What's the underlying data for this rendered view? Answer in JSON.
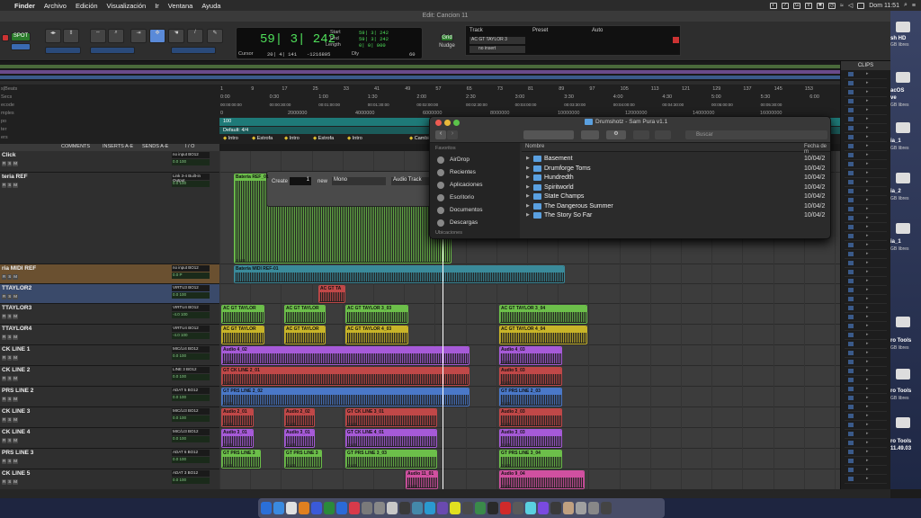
{
  "menubar": {
    "app": "Finder",
    "items": [
      "Archivo",
      "Edición",
      "Visualización",
      "Ir",
      "Ventana",
      "Ayuda"
    ],
    "clock": "Dom 11:51"
  },
  "edit_window": {
    "title": "Edit: Cancion 11"
  },
  "transport": {
    "main_counter": "59| 3| 242",
    "start_label": "Start",
    "end_label": "End",
    "length_label": "Length",
    "start_val": "59| 3| 242",
    "end_val": "59| 3| 242",
    "length_val": "0| 0| 000",
    "cursor_label": "Cursor",
    "cursor_val": "20| 4| 141",
    "sample_val": "-1216805",
    "dly_label": "Dly",
    "tempo_val": "60",
    "grid_label": "Grid",
    "nudge_label": "Nudge",
    "spot_label": "SPOT"
  },
  "track_panel": {
    "track_label": "Track",
    "preset_label": "Preset",
    "auto_label": "Auto",
    "track_value": "AC GT TAYLOR 3",
    "insert_value": "no insert"
  },
  "rulers": {
    "labels": [
      "s|Beats",
      "Secs",
      "ecode",
      "mples",
      "po",
      "ter",
      "ers"
    ],
    "bars": [
      "1",
      "9",
      "17",
      "25",
      "33",
      "41",
      "49",
      "57",
      "65",
      "73",
      "81",
      "89",
      "97",
      "105",
      "113",
      "121",
      "129",
      "137",
      "145",
      "153"
    ],
    "mins": [
      "0:00",
      "0:30",
      "1:00",
      "1:30",
      "2:00",
      "2:30",
      "3:00",
      "3:30",
      "4:00",
      "4:30",
      "5:00",
      "5:30",
      "6:00"
    ],
    "timecode": [
      "00:00:00:00",
      "00:00:30:00",
      "00:01:00:00",
      "00:01:30:00",
      "00:02:00:00",
      "00:02:30:00",
      "00:03:00:00",
      "00:03:30:00",
      "00:04:00:00",
      "00:04:30:00",
      "00:05:00:00",
      "00:05:30:00"
    ],
    "samples": [
      "0",
      "2000000",
      "4000000",
      "6000000",
      "8000000",
      "10000000",
      "12000000",
      "14000000",
      "16000000"
    ],
    "tempo": "100",
    "meter": "Default: 4/4",
    "markers": [
      "Intro",
      "Estrofa",
      "Intro",
      "Estrofa",
      "Intro",
      "Cambio"
    ]
  },
  "column_headers": {
    "comments": "COMMENTS",
    "inserts": "INSERTS A-E",
    "sends": "SENDS A-E",
    "io": "I / O"
  },
  "tracks": [
    {
      "name": "Click",
      "io1": "no input",
      "io2": "BO12",
      "vol": "0.0",
      "pan": "100"
    },
    {
      "name": "teria REF",
      "io1": "Link 3-4",
      "io2": "Built-in Output",
      "vol": "0.0",
      "pan": "100"
    },
    {
      "name": "ria MIDI REF",
      "io1": "no input",
      "io2": "BO12",
      "vol": "0.0",
      "pan": "P"
    },
    {
      "name": "TTAYLOR2",
      "io1": "VIRTU3",
      "io2": "BO12",
      "vol": "0.0",
      "pan": "100"
    },
    {
      "name": "TTAYLOR3",
      "io1": "VIRTU4",
      "io2": "BO12",
      "vol": "-4.0",
      "pan": "100"
    },
    {
      "name": "TTAYLOR4",
      "io1": "VIRTU4",
      "io2": "BO12",
      "vol": "-4.0",
      "pan": "100"
    },
    {
      "name": "CK LINE 1",
      "io1": "MIC/LI4",
      "io2": "BO12",
      "vol": "0.0",
      "pan": "100"
    },
    {
      "name": "CK LINE 2",
      "io1": "LINE 3",
      "io2": "BO12",
      "vol": "0.0",
      "pan": "100"
    },
    {
      "name": "PRS LINE 2",
      "io1": "ADAT 5",
      "io2": "BO12",
      "vol": "0.0",
      "pan": "100"
    },
    {
      "name": "CK LINE 3",
      "io1": "MIC/LI3",
      "io2": "BO12",
      "vol": "0.0",
      "pan": "100"
    },
    {
      "name": "CK LINE 4",
      "io1": "MIC/LI3",
      "io2": "BO12",
      "vol": "0.0",
      "pan": "100"
    },
    {
      "name": "PRS LINE 3",
      "io1": "ADAT 6",
      "io2": "BO12",
      "vol": "0.0",
      "pan": "100"
    },
    {
      "name": "CK LINE 5",
      "io1": "ADAT 3",
      "io2": "BO12",
      "vol": "0.0",
      "pan": "100"
    }
  ],
  "clips": {
    "bateria_ref": "Batería REF_01",
    "bateria_midi": "Batería MIDI REF-01",
    "ac_gt_ta": "AC GT TA",
    "taylor3_a": "AC GT TAYLOR",
    "taylor3_b": "AC GT TAYLOR",
    "taylor3_c": "AC GT TAYLOR 3_03",
    "taylor3_d": "AC GT TAYLOR 3_04",
    "taylor4_a": "AC GT TAYLOR",
    "taylor4_b": "AC GT TAYLOR",
    "taylor4_c": "AC GT TAYLOR 4_03",
    "taylor4_d": "AC GT TAYLOR 4_04",
    "audio4_02": "Audio 4_02",
    "audio4_03": "Audio 4_03",
    "ck_line2_01": "GT CK LINE 2_01",
    "audio5_03": "Audio 5_03",
    "prs_line2_02": "GT PRS LINE 2_02",
    "prs_line2_03": "GT PRS LINE 2_03",
    "audio2_01": "Audio 2_01",
    "audio2_02": "Audio 2_02",
    "ck_line3_01": "GT CK LINE 3_01",
    "audio2_03": "Audio 2_03",
    "audio3_01": "Audio 3_01",
    "audio3_02": "Audio 3_01",
    "ck_line4_01": "GT CK LINE 4_01",
    "audio3_03": "Audio 3_03",
    "prs_line3_a": "GT PRS LINE 3",
    "prs_line3_b": "GT PRS LINE 3",
    "prs_line3_03": "GT PRS LINE 3_03",
    "prs_line3_04": "GT PRS LINE 3_04",
    "audio11_01": "Audio 11_01",
    "audio9_04": "Audio 9_04",
    "db": "0 dB"
  },
  "create_dialog": {
    "create_label": "Create",
    "count": "1",
    "new_label": "new",
    "format": "Mono",
    "type": "Audio Track"
  },
  "finder": {
    "title": "Drumshotz - Sam Pura v1.1",
    "search_placeholder": "Buscar",
    "favorites_label": "Favoritos",
    "sidebar": [
      "AirDrop",
      "Recientes",
      "Aplicaciones",
      "Escritorio",
      "Documentos",
      "Descargas"
    ],
    "locations_label": "Ubicaciones",
    "col_name": "Nombre",
    "col_date": "Fecha de m",
    "rows": [
      {
        "name": "Basement",
        "date": "10/04/2"
      },
      {
        "name": "Drumforge Toms",
        "date": "10/04/2"
      },
      {
        "name": "Hundredth",
        "date": "10/04/2"
      },
      {
        "name": "Spiritworld",
        "date": "10/04/2"
      },
      {
        "name": "State Champs",
        "date": "10/04/2"
      },
      {
        "name": "The Dangerous Summer",
        "date": "10/04/2"
      },
      {
        "name": "The Story So Far",
        "date": "10/04/2"
      }
    ]
  },
  "clips_panel": {
    "title": "CLIPS"
  },
  "desktop": {
    "items": [
      "sh HD",
      "GB libres",
      "acOS",
      "ve",
      "GB libres",
      "ia_1",
      "GB libres",
      "ia_2",
      "GB libres",
      "ia_1",
      "GB libres",
      "ro Tools",
      "GB libres",
      "ro Tools",
      "GB libres",
      "ro Tools",
      "11.49.03"
    ]
  },
  "colors": {
    "accent_green": "#4fe05a",
    "clip_green": "#6cbf4a",
    "clip_purple": "#a65ad8",
    "clip_red": "#c04848",
    "clip_blue": "#4a78c8",
    "clip_yellow": "#c8b428",
    "clip_teal": "#3a8a9a",
    "clip_pink": "#d050a0"
  }
}
